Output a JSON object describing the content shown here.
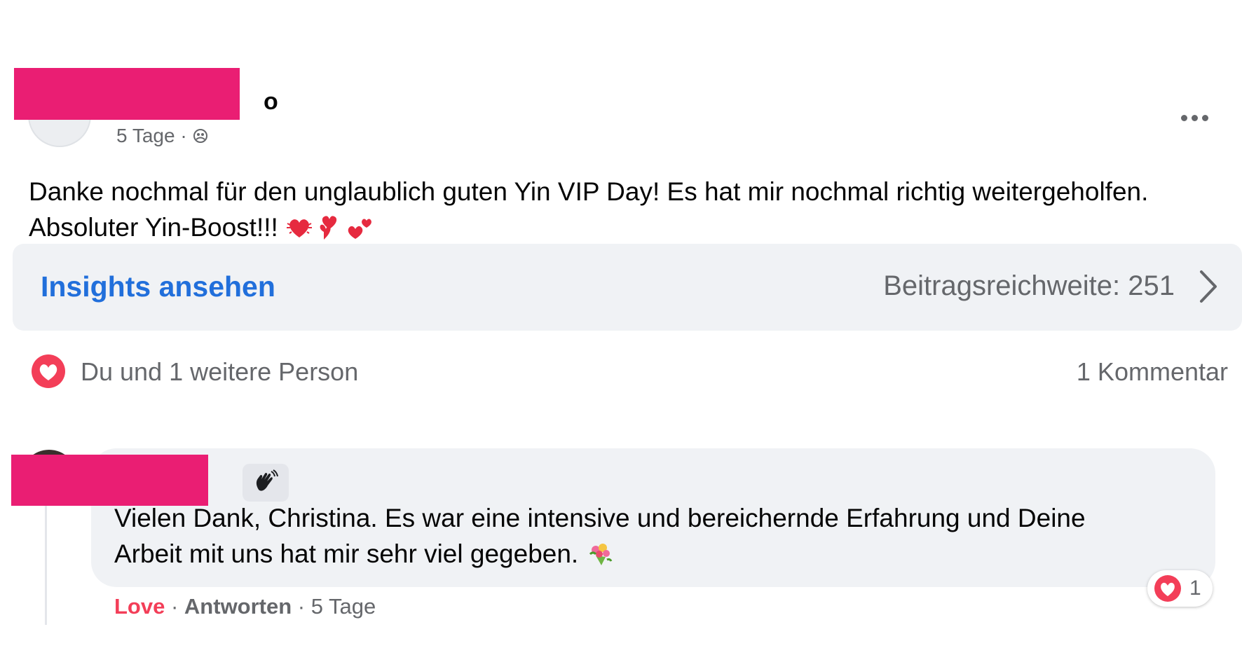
{
  "post": {
    "author_visible_suffix": "o",
    "time": "5 Tage",
    "meta_separator": " · ",
    "text_line1": "Danke nochmal für den unglaublich guten Yin VIP Day! Es hat mir nochmal richtig weitergeholfen.",
    "text_line2": "Absoluter Yin-Boost!!!",
    "emoji_icons": [
      "heartbeat-heart-icon",
      "heart-exclamation-icon",
      "two-hearts-icon"
    ],
    "more_icon": "more-options-icon"
  },
  "insights": {
    "link_label": "Insights ansehen",
    "reach_label": "Beitragsreichweite: 251"
  },
  "reactions": {
    "icon": "love-reaction-icon",
    "text": "Du und 1 weitere Person",
    "comment_count": "1 Kommentar"
  },
  "comment": {
    "badge_icon": "waving-hand-icon",
    "text_line1": "Vielen Dank, Christina. Es war eine intensive und bereichernde Erfahrung und Deine",
    "text_line2": "Arbeit mit uns hat mir sehr viel gegeben.",
    "emoji_icon": "bouquet-icon",
    "reaction_count": "1",
    "action_love": "Love",
    "action_reply": "Antworten",
    "separator": " · ",
    "time": "5 Tage"
  },
  "colors": {
    "redaction": "#ea1e73",
    "link_blue": "#216fdb",
    "love_red": "#f33e58",
    "secondary_text": "#65676b",
    "bubble_bg": "#f0f2f5"
  }
}
